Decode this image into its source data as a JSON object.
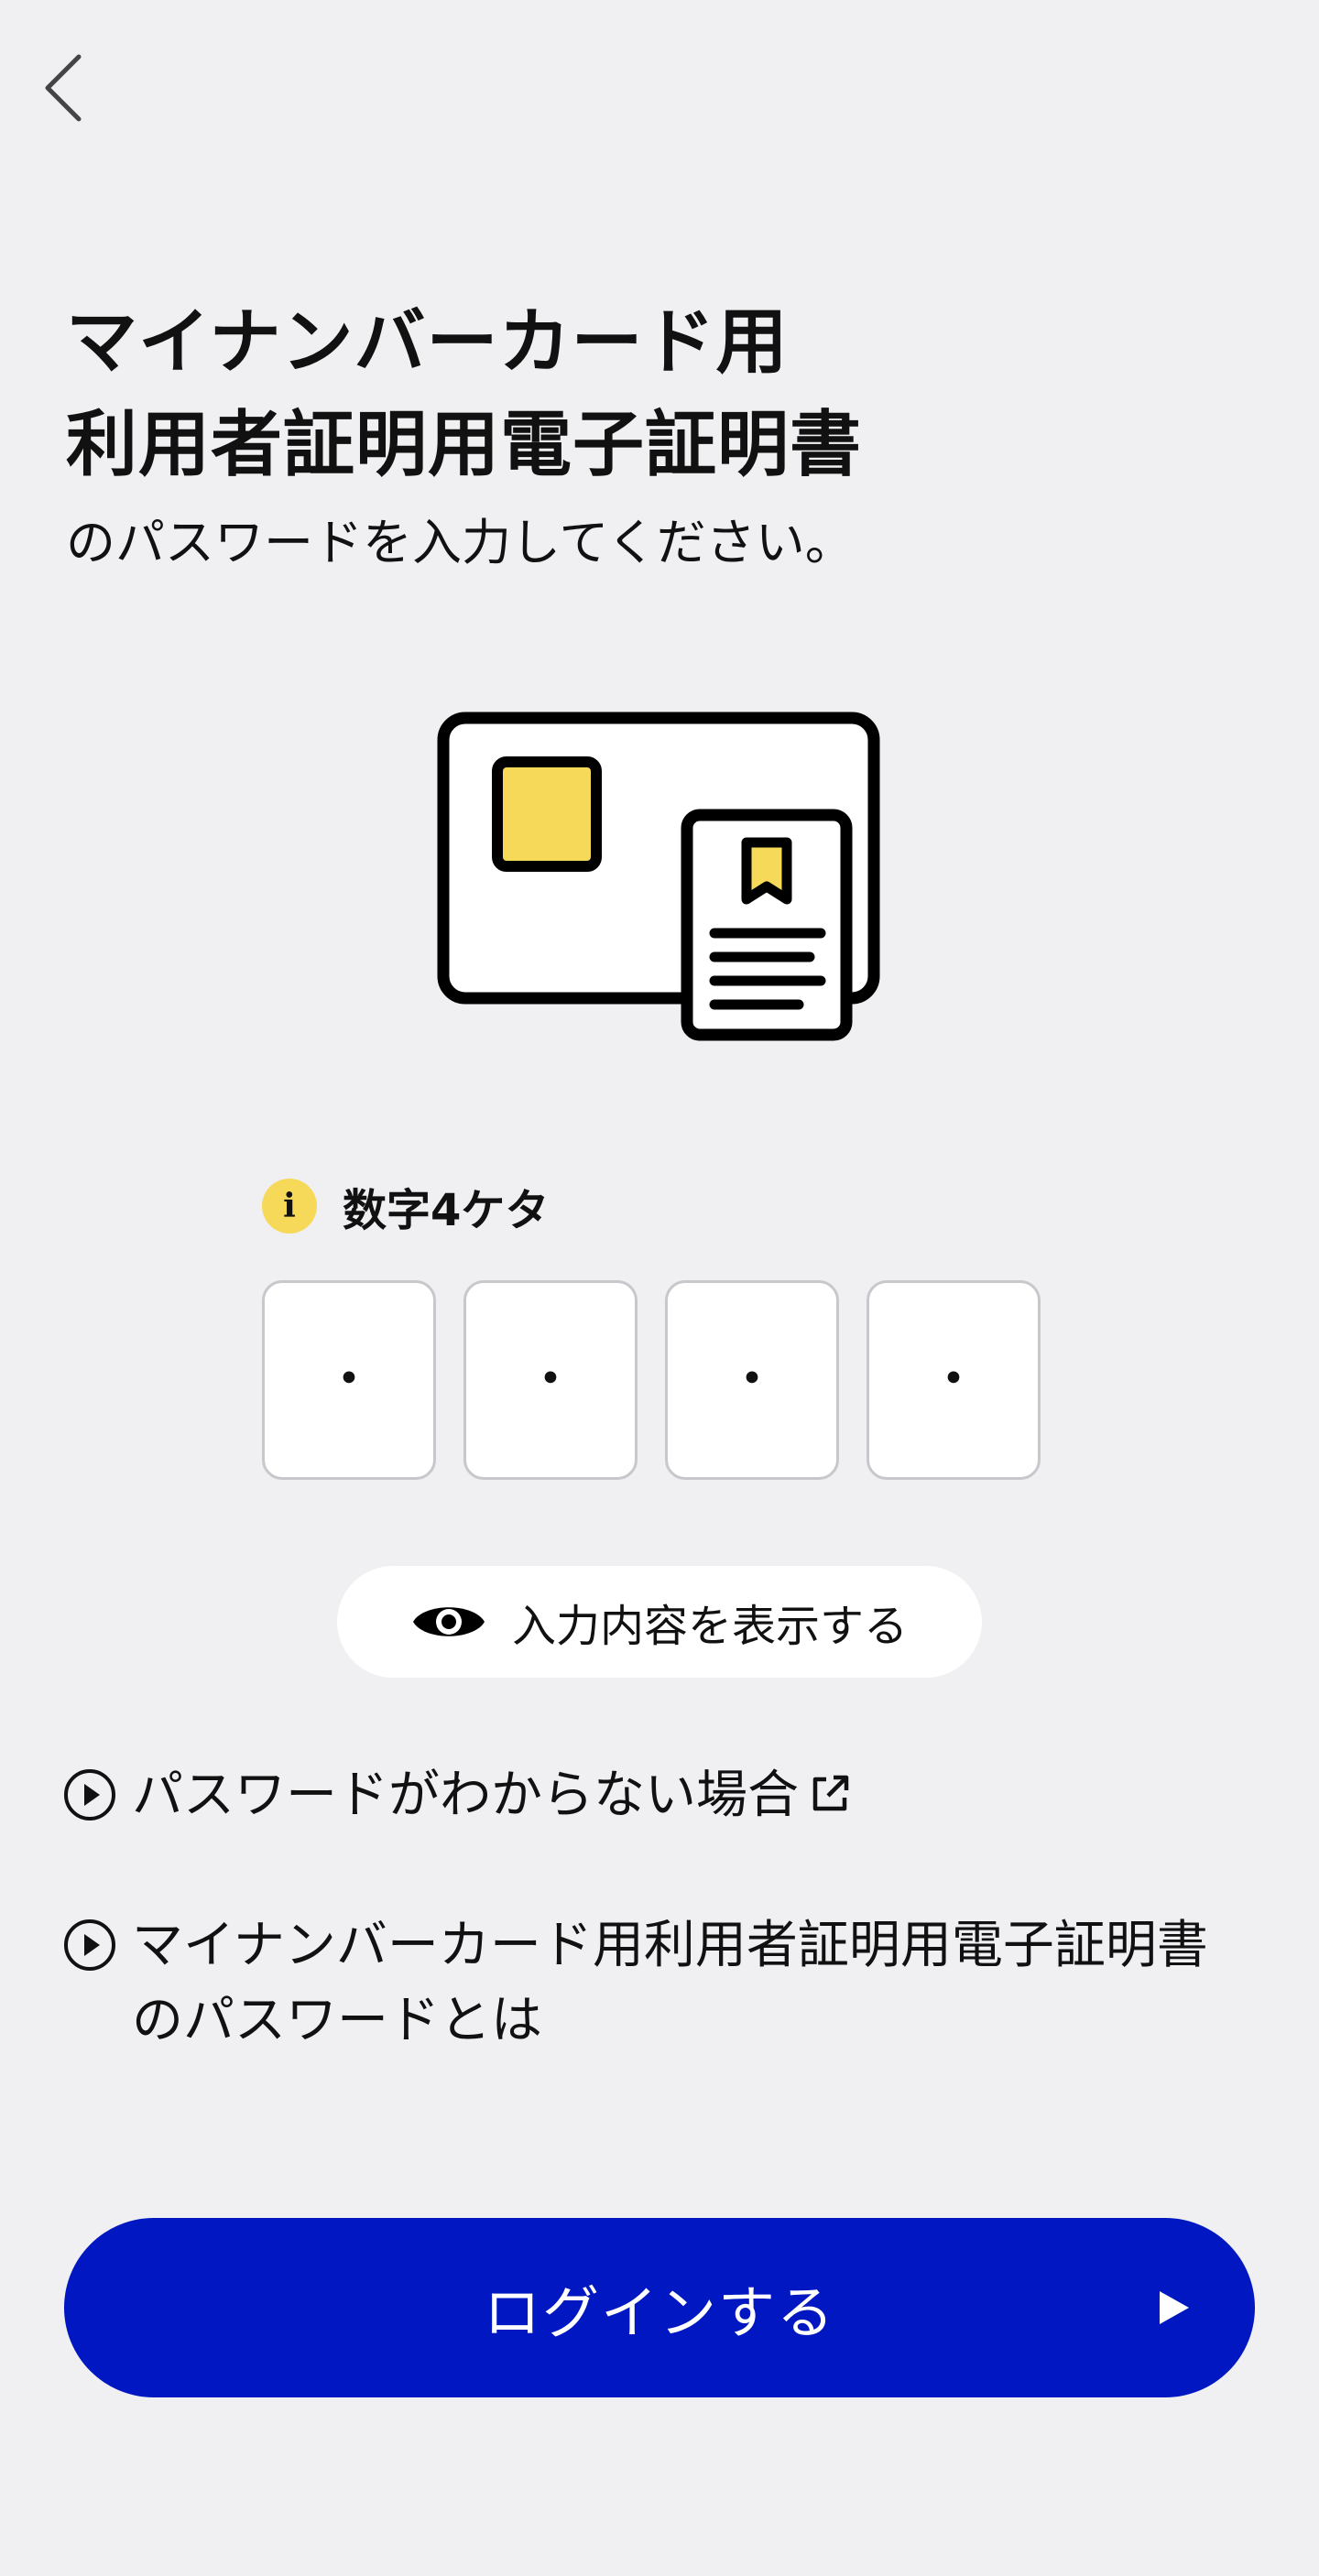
{
  "nav": {
    "back_icon": "chevron-left-icon"
  },
  "heading": {
    "line1": "マイナンバーカード用",
    "line2": "利用者証明用電子証明書",
    "subtitle": "のパスワードを入力してください。"
  },
  "illustration": {
    "icon": "id-card-with-certificate-icon",
    "accent_color": "#f7d95a"
  },
  "hint": {
    "icon": "info-icon",
    "icon_glyph": "i",
    "text": "数字4ケタ"
  },
  "pin": {
    "digits": [
      "・",
      "・",
      "・",
      "・"
    ]
  },
  "toggle_visibility": {
    "icon": "eye-icon",
    "label": "入力内容を表示する"
  },
  "links": [
    {
      "icon": "play-circle-icon",
      "label": "パスワードがわからない場合",
      "trailing_icon": "external-link-icon"
    },
    {
      "icon": "play-circle-icon",
      "label": "マイナンバーカード用利用者証明用電子証明書のパスワードとは"
    }
  ],
  "login": {
    "label": "ログインする",
    "icon": "play-arrow-icon",
    "color": "#0017c1"
  },
  "colors": {
    "background": "#f0f0f3",
    "primary": "#0017c1",
    "accent": "#f7d95a"
  }
}
